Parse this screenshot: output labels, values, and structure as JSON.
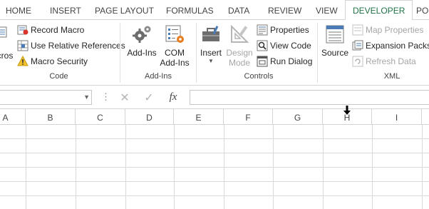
{
  "tabs": [
    {
      "label": "HOME",
      "active": false
    },
    {
      "label": "INSERT",
      "active": false
    },
    {
      "label": "PAGE LAYOUT",
      "active": false
    },
    {
      "label": "FORMULAS",
      "active": false
    },
    {
      "label": "DATA",
      "active": false
    },
    {
      "label": "REVIEW",
      "active": false
    },
    {
      "label": "VIEW",
      "active": false
    },
    {
      "label": "DEVELOPER",
      "active": true
    },
    {
      "label": "PO",
      "active": false
    }
  ],
  "ribbon": {
    "code": {
      "label": "Code",
      "macros_label": "cros",
      "record_macro": "Record Macro",
      "use_relative": "Use Relative References",
      "macro_security": "Macro Security"
    },
    "addins": {
      "label": "Add-Ins",
      "addins_btn": "Add-Ins",
      "com_addins_line1": "COM",
      "com_addins_line2": "Add-Ins"
    },
    "controls": {
      "label": "Controls",
      "insert": "Insert",
      "design_mode_line1": "Design",
      "design_mode_line2": "Mode",
      "properties": "Properties",
      "view_code": "View Code",
      "run_dialog": "Run Dialog"
    },
    "xml": {
      "label": "XML",
      "source": "Source",
      "map_properties": "Map Properties",
      "expansion_packs": "Expansion Packs",
      "refresh_data": "Refresh Data"
    }
  },
  "formula_bar": {
    "name_box": "",
    "formula": "",
    "cancel_glyph": "✕",
    "enter_glyph": "✓",
    "fx_glyph": "fx"
  },
  "columns": [
    "A",
    "B",
    "C",
    "D",
    "E",
    "F",
    "G",
    "H",
    "I"
  ],
  "colors": {
    "accent": "#217346",
    "gridline": "#dadada",
    "disabled": "#a6a6a6"
  }
}
